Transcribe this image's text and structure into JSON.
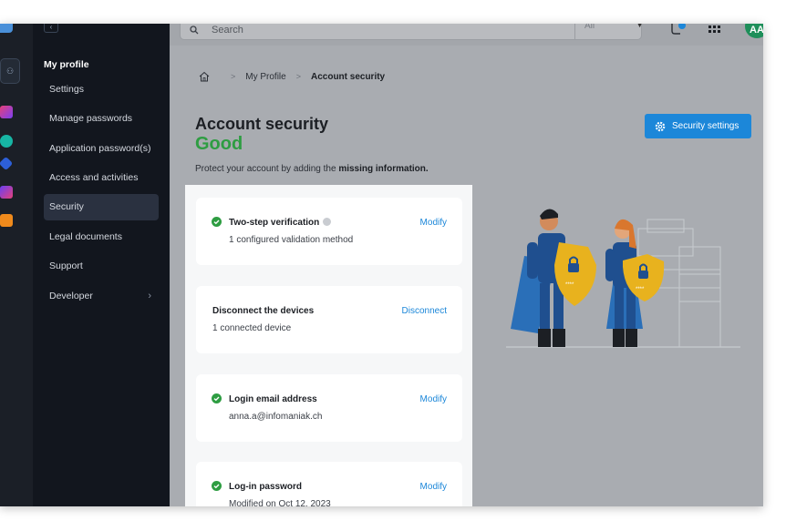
{
  "topbar": {
    "search_placeholder": "Search",
    "scope": "All",
    "avatar_initials": "AA"
  },
  "sidebar": {
    "section_title": "My profile",
    "items": [
      {
        "label": "Settings",
        "active": false
      },
      {
        "label": "Manage passwords",
        "active": false
      },
      {
        "label": "Application password(s)",
        "active": false
      },
      {
        "label": "Access and activities",
        "active": false
      },
      {
        "label": "Security",
        "active": true
      },
      {
        "label": "Legal documents",
        "active": false
      },
      {
        "label": "Support",
        "active": false
      },
      {
        "label": "Developer",
        "active": false,
        "has_submenu": true
      }
    ]
  },
  "breadcrumb": {
    "items": [
      "My Profile",
      "Account security"
    ]
  },
  "main": {
    "title": "Account security",
    "status": "Good",
    "protect_prefix": "Protect your account by adding the ",
    "protect_bold": "missing information.",
    "security_settings_button": "Security settings"
  },
  "cards": [
    {
      "title": "Two-step verification",
      "subtitle": "1 configured validation method",
      "action": "Modify",
      "checked": true,
      "info": true
    },
    {
      "title": "Disconnect the devices",
      "subtitle": "1 connected device",
      "action": "Disconnect",
      "checked": false
    },
    {
      "title": "Login email address",
      "subtitle": "anna.a@infomaniak.ch",
      "action": "Modify",
      "checked": true
    },
    {
      "title": "Log-in password",
      "subtitle": "Modified on Oct 12, 2023",
      "action": "Modify",
      "checked": true
    }
  ],
  "colors": {
    "accent": "#1c87d9",
    "good": "#2e9d42",
    "sidebar_bg": "#12161e",
    "shield": "#e8b21e",
    "hero_blue": "#1f4f8f"
  }
}
